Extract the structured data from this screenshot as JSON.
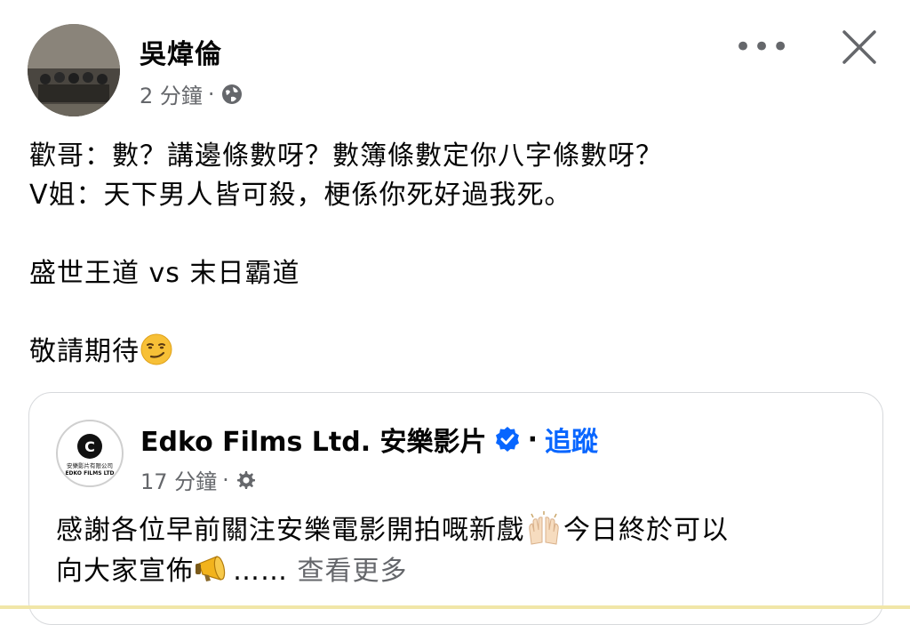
{
  "post": {
    "author": "吳煒倫",
    "time": "2 分鐘",
    "separator": "·",
    "audience_icon": "globe-icon",
    "more_icon": "more-options-icon",
    "close_icon": "close-icon",
    "lines": [
      "歡哥：數？講邊條數呀？數簿條數定你八字條數呀？",
      "V姐：天下男人皆可殺，梗係你死好過我死。",
      "盛世王道 vs 末日霸道",
      "敬請期待"
    ],
    "emoji": "smirking-face-emoji"
  },
  "shared": {
    "page_name": "Edko Films Ltd. 安樂影片",
    "verified_icon": "verified-badge-icon",
    "separator": "·",
    "follow_label": "追蹤",
    "time": "17 分鐘",
    "gear_icon": "gear-icon",
    "line1": "感謝各位早前關注安樂電影開拍嘅新戲",
    "line1_after": "今日終於可以",
    "line2": "向大家宣佈",
    "ellipsis": "……",
    "see_more": "查看更多",
    "logo_text_1": "安樂影片有限公司",
    "logo_text_2": "EDKO FILMS LTD",
    "logo_letter": "C"
  },
  "colors": {
    "text": "#050505",
    "secondary": "#65676b",
    "link": "#0866ff",
    "border": "#d7d9dc"
  }
}
